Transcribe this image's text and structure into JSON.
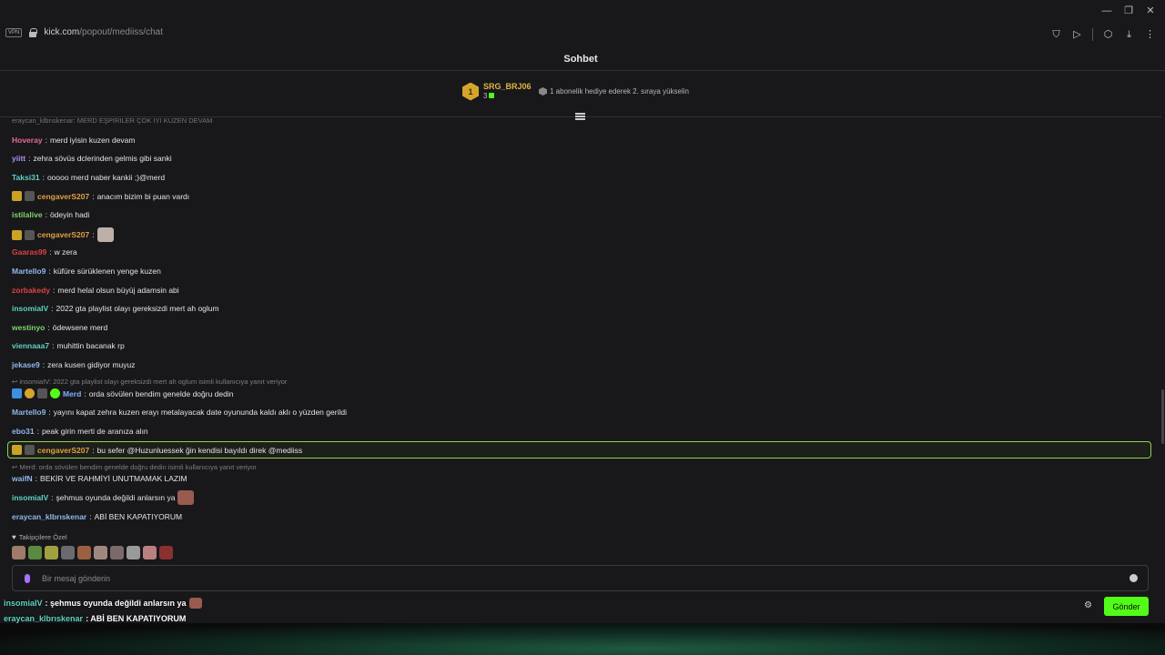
{
  "browser": {
    "vpn": "VPN",
    "url_host": "kick.com",
    "url_path": "/popout/mediiss/chat"
  },
  "chat": {
    "title": "Sohbet",
    "top_gifter": {
      "rank": "1",
      "name": "SRG_BRJ06",
      "count": "3"
    },
    "gift_hint": "1 abonelik hediye ederek 2. sıraya yükselin",
    "truncated_top": "eraycan_klbrıskenar: MERD EŞPIRILER ÇOK IYI KUZEN DEVAM",
    "messages": [
      {
        "user": "Hoveray",
        "color": "#e86a9a",
        "text": "merd iyisin kuzen devam"
      },
      {
        "user": "yiitt",
        "color": "#b28cf0",
        "text": "zehra sövüs dclerinden gelmis gibi sanki"
      },
      {
        "user": "Taksi31",
        "color": "#5fd3c0",
        "text": "ooooo merd naber kankii ;)@merd"
      },
      {
        "user": "cengaverS207",
        "color": "#e0a040",
        "text": "anacım bizim bi puan vardı"
      },
      {
        "user": "istilalive",
        "color": "#7fd36c",
        "text": "ödeyin hadi"
      },
      {
        "user": "cengaverS207",
        "color": "#e0a040",
        "text": ""
      },
      {
        "user": "Gaaras99",
        "color": "#e04040",
        "text": "w zera"
      },
      {
        "user": "Martello9",
        "color": "#8fb8e8",
        "text": "küfüre sürüklenen yenge kuzen"
      },
      {
        "user": "zorbakedy",
        "color": "#e04040",
        "text": "merd helal olsun büyüj adamsin abi"
      },
      {
        "user": "insomiaIV",
        "color": "#5fd3c0",
        "text": "2022 gta playlist olayı gereksizdi mert ah oglum"
      },
      {
        "user": "westinyo",
        "color": "#7fd36c",
        "text": "ödewsene merd"
      },
      {
        "user": "viennaaa7",
        "color": "#5fd3c0",
        "text": "muhittin bacanak rp"
      },
      {
        "user": "jekase9",
        "color": "#8fb8e8",
        "text": "zera kusen gidiyor muyuz"
      }
    ],
    "reply1": "insomiaIV: 2022 gta playlist olayı gereksizdi mert ah oglum isimli kullanıcıya yanıt veriyor",
    "merd": {
      "user": "Merd",
      "color": "#7fb0ff",
      "text": "orda sövülen bendim genelde doğru dedin"
    },
    "after": [
      {
        "user": "Martello9",
        "color": "#8fb8e8",
        "text": "yayını kapat zehra kuzen erayı metalayacak date oyununda kaldı aklı o yüzden gerildi"
      },
      {
        "user": "ebo31",
        "color": "#8fb8e8",
        "text": "peak girin merti de aranıza alın"
      }
    ],
    "highlighted": {
      "user": "cengaverS207",
      "color": "#e0a040",
      "text": "bu sefer @Huzunluessek ğin kendisi bayıldı direk @mediiss"
    },
    "reply2": "Merd: orda sövülen bendim genelde doğru dedin isimli kullanıcıya yanıt veriyor",
    "last": [
      {
        "user": "waifN",
        "color": "#8fb8e8",
        "text": "BEKİR VE RAHMİYİ UNUTMAMAK LAZIM"
      },
      {
        "user": "insomiaIV",
        "color": "#5fd3c0",
        "text": "şehmus oyunda değildi anlarsın ya"
      },
      {
        "user": "eraycan_klbrıskenar",
        "color": "#8fb8e8",
        "text": "ABİ BEN KAPATIYORUM"
      }
    ],
    "emote_label": "Takipçilere Özel",
    "input_placeholder": "Bir mesaj gönderin",
    "send_label": "Gönder"
  },
  "overlay": [
    {
      "user": "insomiaIV",
      "color": "#5fd3c0",
      "text": ": şehmus oyunda değildi anlarsın ya"
    },
    {
      "user": "eraycan_klbrıskenar",
      "color": "#5fd3c0",
      "text": ": ABİ BEN KAPATIYORUM"
    }
  ]
}
